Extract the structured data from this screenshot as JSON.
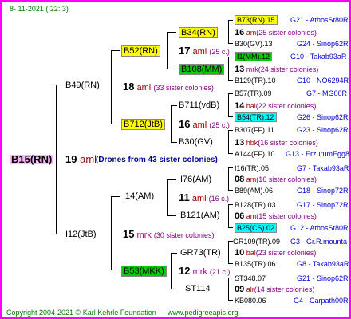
{
  "header": "8-  11-2021  ( 22:  3)",
  "footer": {
    "copy": "Copyright 2004-2021 © Karl Kehrle Foundation",
    "site": "www.pedigreeapis.org"
  },
  "root": {
    "name": "B15(RN)",
    "num": "19",
    "unit": "aml",
    "note": "(Drones from 43 sister colonies)"
  },
  "gen1": [
    {
      "name": "B49(RN)",
      "num": "18",
      "unit": "aml",
      "note": "(33 sister colonies)"
    },
    {
      "name": "I12(JtB)",
      "num": "15",
      "unit": "mrk",
      "note": "(30 sister colonies)"
    }
  ],
  "gen2": [
    {
      "name": "B52(RN)",
      "num": "17",
      "unit": "aml",
      "note": "(25 c.)"
    },
    {
      "name": "B712(JtB)",
      "num": "16",
      "unit": "aml",
      "note": "(25 c.)"
    },
    {
      "name": "I14(AM)",
      "num": "11",
      "unit": "aml",
      "note": "(16 c.)"
    },
    {
      "name": "B53(MKK)",
      "num": "12",
      "unit": "mrk",
      "note": "(21 c.)"
    }
  ],
  "gen3": [
    {
      "name": "B34(RN)",
      "num": "16",
      "unit": "am",
      "note": "(25 sister colonies)"
    },
    {
      "name": "B108(MM)",
      "num": "13",
      "unit": "mrk",
      "note": "(24 sister colonies)"
    },
    {
      "name": "B711(vdB)",
      "num": "14",
      "unit": "bal",
      "note": "(22 sister colonies)"
    },
    {
      "name": "B30(GV)",
      "num": "13",
      "unit": "hbk",
      "note": "(16 sister colonies)"
    },
    {
      "name": "I76(AM)",
      "num": "08",
      "unit": "am",
      "note": "(16 sister colonies)"
    },
    {
      "name": "B121(AM)",
      "num": "06",
      "unit": "am",
      "note": "(15 sister colonies)"
    },
    {
      "name": "GR73(TR)",
      "num": "10",
      "unit": "bal",
      "note": "(23 sister colonies)"
    },
    {
      "name": "ST114",
      "num": "09",
      "unit": "alr",
      "note": "(14 sister colonies)"
    }
  ],
  "gen4": [
    {
      "name": "B73(RN).15",
      "code": "G21 - AthosSt80R"
    },
    {
      "name": "B30(GV).13",
      "code": "G24 - Sinop62R"
    },
    {
      "name": "I1(MM).12",
      "code": "G10 - Takab93aR"
    },
    {
      "name": "B129(TR).10",
      "code": "G10 - NO6294R"
    },
    {
      "name": "B57(TR).09",
      "code": "G7 - MG00R"
    },
    {
      "name": "B54(TR).12",
      "code": "G26 - Sinop62R"
    },
    {
      "name": "B307(FF).11",
      "code": "G23 - Sinop62R"
    },
    {
      "name": "A144(FF).10",
      "code": "G13 - ErzurumEgg8"
    },
    {
      "name": "I16(TR).05",
      "code": "G7 - Takab93aR"
    },
    {
      "name": "B89(AM).06",
      "code": "G18 - Sinop72R"
    },
    {
      "name": "B128(TR).03",
      "code": "G17 - Sinop72R"
    },
    {
      "name": "B25(CS).02",
      "code": "G12 - AthosSt80R"
    },
    {
      "name": "GR109(TR).09",
      "code": "G3 - Gr.R.mounta"
    },
    {
      "name": "B135(TR).06",
      "code": "G8 - Takab93aR"
    },
    {
      "name": "ST348.07",
      "code": "G21 - Sinop62R"
    },
    {
      "name": "KB080.06",
      "code": "G4 - Carpath00R"
    }
  ],
  "colors": {
    "border": "#ff00ff",
    "yellow": "#ffff00",
    "green": "#00cc00",
    "cyan": "#00ffff",
    "code": "#0000cc"
  }
}
